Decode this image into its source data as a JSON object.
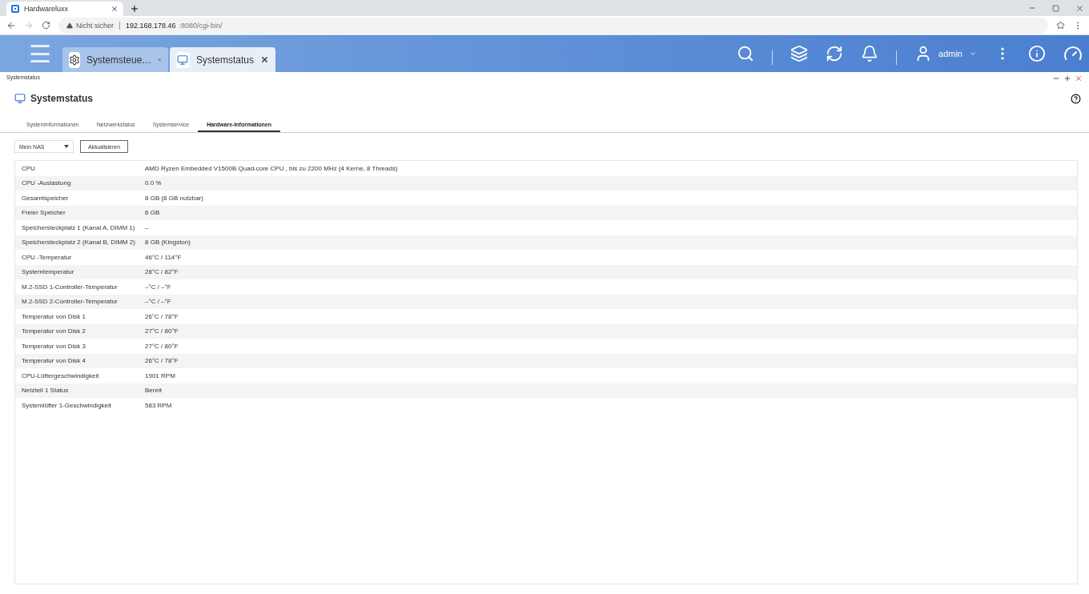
{
  "browser": {
    "tab_title": "Hardwareluxx",
    "security": "Nicht sicher",
    "url_host": "192.168.178.46",
    "url_path": ":8080/cgi-bin/"
  },
  "app_tabs": [
    {
      "label": "Systemsteue…",
      "kind": "settings",
      "selected": false
    },
    {
      "label": "Systemstatus",
      "kind": "status",
      "selected": true
    }
  ],
  "user": {
    "name": "admin"
  },
  "window": {
    "breadcrumb": "Systemstatus",
    "title": "Systemstatus"
  },
  "tabs": [
    {
      "label": "Systeminformationen",
      "selected": false
    },
    {
      "label": "Netzwerkstatus",
      "selected": false
    },
    {
      "label": "Systemservice",
      "selected": false
    },
    {
      "label": "Hardware-Informationen",
      "selected": true
    }
  ],
  "device_select": {
    "value": "Mein NAS"
  },
  "refresh_button": "Aktualisieren",
  "rows": [
    {
      "name": "CPU",
      "value": "AMD Ryzen Embedded V1500B Quad-core CPU , bis zu 2200 MHz (4 Kerne, 8 Threads)"
    },
    {
      "name": "CPU -Auslastung",
      "value": "0.0 %"
    },
    {
      "name": "Gesamtspeicher",
      "value": "8 GB (8 GB nutzbar)"
    },
    {
      "name": "Freier Speicher",
      "value": "6 GB"
    },
    {
      "name": "Speichersteckplatz 1 (Kanal A, DIMM 1)",
      "value": "–"
    },
    {
      "name": "Speichersteckplatz 2 (Kanal B, DIMM 2)",
      "value": "8 GB (Kingston)"
    },
    {
      "name": "CPU -Temperatur",
      "value": "46°C / 114°F"
    },
    {
      "name": "Systemtemperatur",
      "value": "28°C / 82°F"
    },
    {
      "name": "M.2-SSD 1-Controller-Temperatur",
      "value": "–°C / –°F"
    },
    {
      "name": "M.2-SSD 2-Controller-Temperatur",
      "value": "–°C / –°F"
    },
    {
      "name": "Temperatur von Disk 1",
      "value": "26°C / 78°F"
    },
    {
      "name": "Temperatur von Disk 2",
      "value": "27°C / 80°F"
    },
    {
      "name": "Temperatur von Disk 3",
      "value": "27°C / 80°F"
    },
    {
      "name": "Temperatur von Disk 4",
      "value": "26°C / 78°F"
    },
    {
      "name": "CPU-Lüftergeschwindigkeit",
      "value": "1901 RPM"
    },
    {
      "name": "Netzteil 1 Status",
      "value": "Bereit"
    },
    {
      "name": "Systemlüfter 1-Geschwindigkeit",
      "value": "583 RPM"
    }
  ]
}
